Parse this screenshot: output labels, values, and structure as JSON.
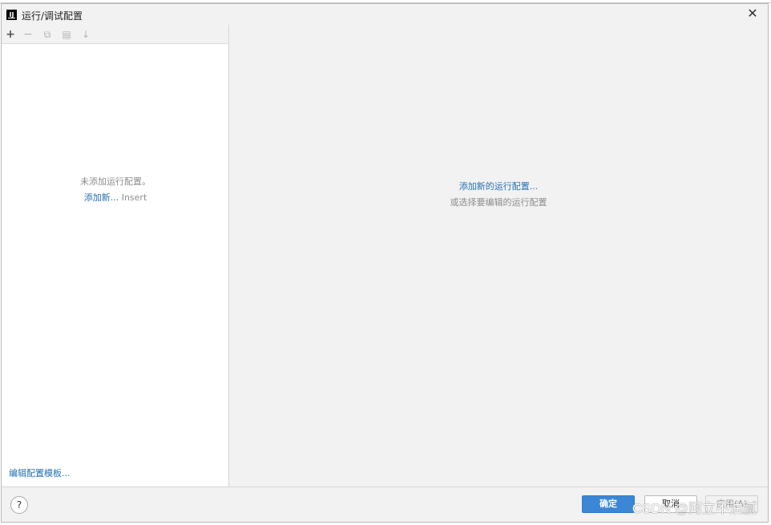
{
  "window": {
    "title": "运行/调试配置",
    "app_icon_text": "IJ",
    "close_glyph": "✕"
  },
  "toolbar": {
    "add_glyph": "+",
    "remove_glyph": "−",
    "copy_glyph": "⧉",
    "folder_glyph": "▤",
    "sort_glyph": "↓"
  },
  "left_panel": {
    "empty_text": "未添加运行配置。",
    "add_new_link": "添加新...",
    "add_new_shortcut": "Insert",
    "edit_templates_link": "编辑配置模板..."
  },
  "right_panel": {
    "add_new_link": "添加新的运行配置...",
    "hint_text": "或选择要编辑的运行配置"
  },
  "footer": {
    "help_glyph": "?",
    "ok_label": "确定",
    "cancel_label": "取消",
    "apply_label": "应用(A)"
  },
  "watermark": "CSDN @阿立不油腻",
  "colors": {
    "link": "#2470b3",
    "primary_button": "#3b87d6",
    "muted_text": "#8c8c8c",
    "panel_bg": "#f2f2f2"
  }
}
